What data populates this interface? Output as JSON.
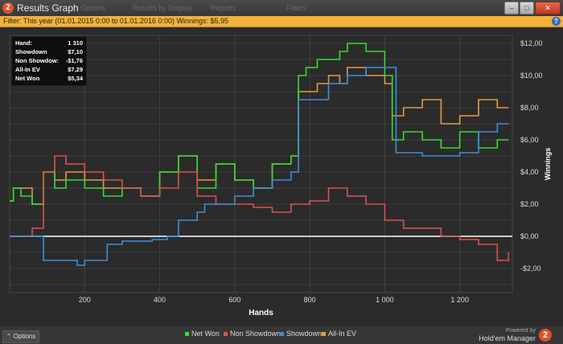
{
  "window": {
    "title": "Results Graph",
    "app_icon_text": "2",
    "ghost_menus": [
      "Options",
      "Results by Display",
      "Reports",
      "Filters"
    ],
    "buttons": {
      "minimize": "–",
      "maximize": "□",
      "close": "✕"
    }
  },
  "filter": {
    "text": "Filter: This year (01.01.2015 0:00 to 01.01.2016 0:00)  Winnings: $5,95",
    "help": "?"
  },
  "stats": [
    {
      "label": "Hand:",
      "value": "1 310"
    },
    {
      "label": "Showdown",
      "value": "$7,10"
    },
    {
      "label": "Non Showdow:",
      "value": "-$1,76"
    },
    {
      "label": "All-In EV",
      "value": "$7,29"
    },
    {
      "label": "Net Won",
      "value": "$5,34"
    }
  ],
  "chart_data": {
    "type": "line",
    "xlabel": "Hands",
    "ylabel": "Winnings",
    "xlim": [
      0,
      1340
    ],
    "ylim": [
      -3.5,
      12.5
    ],
    "x_ticks": [
      200,
      400,
      600,
      800,
      1000,
      1200
    ],
    "x_tick_labels": [
      "200",
      "400",
      "600",
      "800",
      "1 000",
      "1 200"
    ],
    "y_ticks": [
      -2,
      0,
      2,
      4,
      6,
      8,
      10,
      12
    ],
    "y_tick_labels": [
      "-$2,00",
      "$0,00",
      "$2,00",
      "$4,00",
      "$6,00",
      "$8,00",
      "$10,00",
      "$12,00"
    ],
    "grid": true,
    "legend_position": "bottom",
    "series": [
      {
        "name": "Net Won",
        "color": "#33dd33",
        "x": [
          0,
          10,
          30,
          60,
          90,
          120,
          150,
          200,
          250,
          300,
          350,
          400,
          450,
          500,
          550,
          600,
          650,
          700,
          750,
          770,
          790,
          820,
          850,
          880,
          900,
          950,
          1000,
          1020,
          1050,
          1100,
          1150,
          1200,
          1250,
          1300,
          1330
        ],
        "values": [
          2.2,
          3.0,
          2.5,
          2.0,
          4.0,
          3.0,
          3.5,
          3.0,
          2.5,
          3.0,
          2.5,
          4.0,
          5.0,
          3.0,
          4.5,
          3.5,
          3.0,
          4.5,
          5.0,
          10.0,
          10.5,
          11.0,
          11.0,
          11.5,
          12.0,
          11.5,
          10.0,
          6.0,
          6.5,
          6.0,
          5.5,
          6.5,
          5.5,
          6.0,
          6.0
        ]
      },
      {
        "name": "Non Showdown",
        "color": "#e05050",
        "x": [
          0,
          60,
          90,
          120,
          150,
          200,
          250,
          300,
          350,
          400,
          450,
          500,
          550,
          600,
          650,
          700,
          750,
          800,
          850,
          900,
          950,
          1000,
          1050,
          1100,
          1150,
          1200,
          1250,
          1300,
          1330
        ],
        "values": [
          0.0,
          0.5,
          4.0,
          5.0,
          4.5,
          4.0,
          3.5,
          3.0,
          2.5,
          3.0,
          4.0,
          2.5,
          2.0,
          2.0,
          1.8,
          1.5,
          2.0,
          2.2,
          3.0,
          2.5,
          2.0,
          1.0,
          0.5,
          0.5,
          0.0,
          -0.2,
          -0.5,
          -1.5,
          -1.0
        ]
      },
      {
        "name": "Showdown",
        "color": "#3a8fd9",
        "x": [
          0,
          90,
          180,
          200,
          260,
          300,
          380,
          420,
          450,
          500,
          520,
          560,
          600,
          650,
          700,
          750,
          770,
          850,
          900,
          950,
          1000,
          1030,
          1100,
          1150,
          1200,
          1250,
          1300,
          1330
        ],
        "values": [
          0.0,
          -1.5,
          -1.8,
          -1.5,
          -0.5,
          -0.3,
          -0.2,
          0.0,
          1.0,
          1.5,
          2.0,
          2.0,
          2.5,
          3.0,
          3.5,
          4.0,
          8.5,
          9.5,
          10.0,
          10.5,
          10.5,
          5.2,
          5.0,
          5.0,
          5.2,
          6.5,
          7.0,
          7.0
        ]
      },
      {
        "name": "All-In EV",
        "color": "#e39b3c",
        "x": [
          0,
          10,
          60,
          90,
          120,
          150,
          200,
          250,
          300,
          350,
          400,
          450,
          500,
          550,
          600,
          650,
          700,
          750,
          770,
          790,
          820,
          850,
          880,
          900,
          950,
          1000,
          1020,
          1050,
          1100,
          1150,
          1200,
          1250,
          1300,
          1330
        ],
        "values": [
          2.2,
          3.0,
          2.0,
          4.0,
          3.5,
          4.0,
          3.5,
          3.0,
          3.0,
          2.5,
          4.0,
          5.0,
          3.5,
          4.5,
          3.5,
          3.0,
          4.5,
          5.0,
          9.0,
          9.0,
          9.5,
          10.0,
          9.5,
          10.5,
          10.0,
          9.5,
          7.5,
          8.0,
          8.5,
          7.0,
          7.5,
          8.5,
          8.0,
          8.0
        ]
      }
    ]
  },
  "legend": [
    {
      "label": "Net Won",
      "color": "#33dd33"
    },
    {
      "label": "Non Showdown",
      "color": "#e05050"
    },
    {
      "label": "Showdown",
      "color": "#3a8fd9"
    },
    {
      "label": "All-In EV",
      "color": "#e39b3c"
    }
  ],
  "options_label": "Options",
  "branding": {
    "powered_by": "Powered by",
    "name": "Hold'em Manager",
    "logo_text": "2"
  }
}
